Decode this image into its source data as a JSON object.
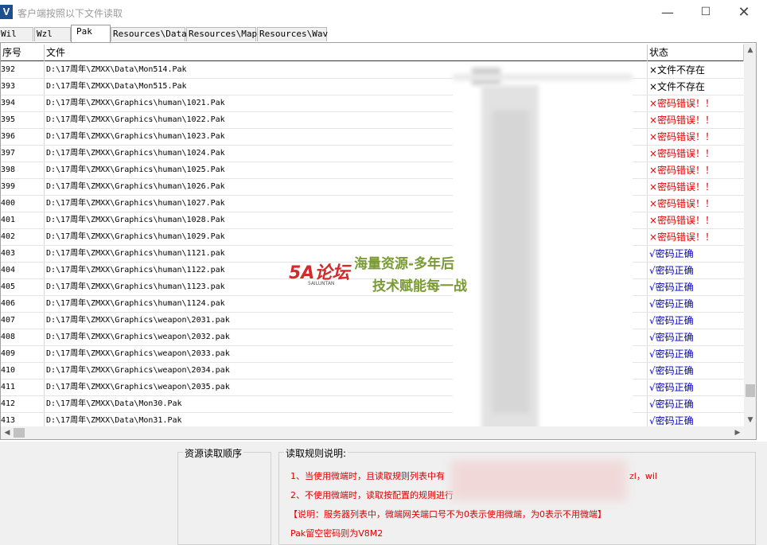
{
  "window": {
    "title": "客户端按照以下文件读取",
    "icon": "app-v-icon"
  },
  "tabs": [
    {
      "label": "Wil"
    },
    {
      "label": "Wzl"
    },
    {
      "label": "Pak",
      "active": true
    },
    {
      "label": "Resources\\Data"
    },
    {
      "label": "Resources\\Map"
    },
    {
      "label": "Resources\\Wav"
    }
  ],
  "grid": {
    "columns": {
      "no": "序号",
      "file": "文件",
      "status": "状态"
    },
    "rows": [
      {
        "no": "392",
        "file": "D:\\17周年\\ZMXX\\Data\\Mon514.Pak",
        "status": "×文件不存在",
        "kind": "missing"
      },
      {
        "no": "393",
        "file": "D:\\17周年\\ZMXX\\Data\\Mon515.Pak",
        "status": "×文件不存在",
        "kind": "missing"
      },
      {
        "no": "394",
        "file": "D:\\17周年\\ZMXX\\Graphics\\human\\1021.Pak",
        "status": "×密码错误！！",
        "kind": "error"
      },
      {
        "no": "395",
        "file": "D:\\17周年\\ZMXX\\Graphics\\human\\1022.Pak",
        "status": "×密码错误！！",
        "kind": "error"
      },
      {
        "no": "396",
        "file": "D:\\17周年\\ZMXX\\Graphics\\human\\1023.Pak",
        "status": "×密码错误！！",
        "kind": "error"
      },
      {
        "no": "397",
        "file": "D:\\17周年\\ZMXX\\Graphics\\human\\1024.Pak",
        "status": "×密码错误！！",
        "kind": "error"
      },
      {
        "no": "398",
        "file": "D:\\17周年\\ZMXX\\Graphics\\human\\1025.Pak",
        "status": "×密码错误！！",
        "kind": "error"
      },
      {
        "no": "399",
        "file": "D:\\17周年\\ZMXX\\Graphics\\human\\1026.Pak",
        "status": "×密码错误！！",
        "kind": "error"
      },
      {
        "no": "400",
        "file": "D:\\17周年\\ZMXX\\Graphics\\human\\1027.Pak",
        "status": "×密码错误！！",
        "kind": "error"
      },
      {
        "no": "401",
        "file": "D:\\17周年\\ZMXX\\Graphics\\human\\1028.Pak",
        "status": "×密码错误！！",
        "kind": "error"
      },
      {
        "no": "402",
        "file": "D:\\17周年\\ZMXX\\Graphics\\human\\1029.Pak",
        "status": "×密码错误！！",
        "kind": "error"
      },
      {
        "no": "403",
        "file": "D:\\17周年\\ZMXX\\Graphics\\human\\1121.pak",
        "status": "√密码正确",
        "kind": "ok"
      },
      {
        "no": "404",
        "file": "D:\\17周年\\ZMXX\\Graphics\\human\\1122.pak",
        "status": "√密码正确",
        "kind": "ok"
      },
      {
        "no": "405",
        "file": "D:\\17周年\\ZMXX\\Graphics\\human\\1123.pak",
        "status": "√密码正确",
        "kind": "ok"
      },
      {
        "no": "406",
        "file": "D:\\17周年\\ZMXX\\Graphics\\human\\1124.pak",
        "status": "√密码正确",
        "kind": "ok"
      },
      {
        "no": "407",
        "file": "D:\\17周年\\ZMXX\\Graphics\\weapon\\2031.pak",
        "status": "√密码正确",
        "kind": "ok"
      },
      {
        "no": "408",
        "file": "D:\\17周年\\ZMXX\\Graphics\\weapon\\2032.pak",
        "status": "√密码正确",
        "kind": "ok"
      },
      {
        "no": "409",
        "file": "D:\\17周年\\ZMXX\\Graphics\\weapon\\2033.pak",
        "status": "√密码正确",
        "kind": "ok"
      },
      {
        "no": "410",
        "file": "D:\\17周年\\ZMXX\\Graphics\\weapon\\2034.pak",
        "status": "√密码正确",
        "kind": "ok"
      },
      {
        "no": "411",
        "file": "D:\\17周年\\ZMXX\\Graphics\\weapon\\2035.pak",
        "status": "√密码正确",
        "kind": "ok"
      },
      {
        "no": "412",
        "file": "D:\\17周年\\ZMXX\\Data\\Mon30.Pak",
        "status": "√密码正确",
        "kind": "ok"
      },
      {
        "no": "413",
        "file": "D:\\17周年\\ZMXX\\Data\\Mon31.Pak",
        "status": "√密码正确",
        "kind": "ok"
      }
    ]
  },
  "status_colors": {
    "missing": "#000000",
    "error": "#e00000",
    "ok": "#0000c0"
  },
  "bottom": {
    "order_label": "资源读取顺序",
    "rules_label": "读取规则说明:",
    "rule1": "1、当使用微端时，且读取规则列表中有",
    "rule1_tail": "zl，wil",
    "rule2": "2、不使用微端时，读取按配置的规则进行",
    "note": "【说明：服务器列表中，微端网关端口号不为0表示使用微端，为0表示不用微端】",
    "pak_note": "Pak留空密码则为V8M2"
  },
  "watermark": {
    "logo": "5A论坛",
    "sub": "5AILUNTAN",
    "line1": "海量资源-多年后",
    "line2": "技术赋能每一战"
  }
}
